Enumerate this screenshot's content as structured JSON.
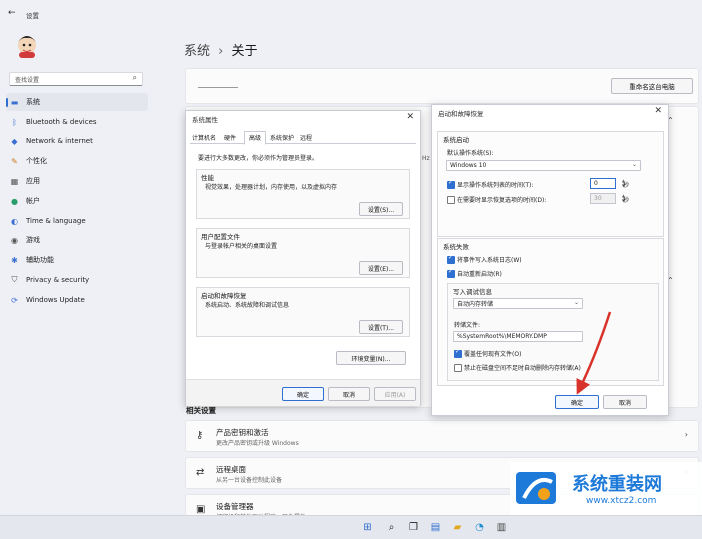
{
  "window": {
    "back_glyph": "←",
    "title": "设置"
  },
  "sidebar": {
    "search_placeholder": "查找设置",
    "items": [
      {
        "label": "系统",
        "icon": "monitor-icon",
        "glyph": "▬"
      },
      {
        "label": "Bluetooth & devices",
        "icon": "bluetooth-icon",
        "glyph": "ᛒ"
      },
      {
        "label": "Network & internet",
        "icon": "wifi-icon",
        "glyph": "◆"
      },
      {
        "label": "个性化",
        "icon": "brush-icon",
        "glyph": "✎"
      },
      {
        "label": "应用",
        "icon": "apps-icon",
        "glyph": "▦"
      },
      {
        "label": "帐户",
        "icon": "person-icon",
        "glyph": "●"
      },
      {
        "label": "Time & language",
        "icon": "globe-clock-icon",
        "glyph": "◐"
      },
      {
        "label": "游戏",
        "icon": "gamepad-icon",
        "glyph": "◉"
      },
      {
        "label": "辅助功能",
        "icon": "accessibility-icon",
        "glyph": "✱"
      },
      {
        "label": "Privacy & security",
        "icon": "shield-icon",
        "glyph": "⛉"
      },
      {
        "label": "Windows Update",
        "icon": "update-icon",
        "glyph": "⟳"
      }
    ]
  },
  "main": {
    "breadcrumb_root": "系统",
    "breadcrumb_sep": "›",
    "breadcrumb_current": "关于",
    "rename_button": "重命名这台电脑",
    "related_heading": "相关设置",
    "related": [
      {
        "title": "产品密钥和激活",
        "subtitle": "更改产品密钥或升级 Windows",
        "icon": "key-icon",
        "glyph": "⚷",
        "arrow": "›"
      },
      {
        "title": "远程桌面",
        "subtitle": "从另一台设备控制此设备",
        "icon": "remote-desktop-icon",
        "glyph": "⇄",
        "arrow": "›"
      },
      {
        "title": "设备管理器",
        "subtitle": "打印机和其他驱动程序、硬件属性",
        "icon": "device-manager-icon",
        "glyph": "▣",
        "arrow": ""
      }
    ],
    "partial_text": "Hz"
  },
  "system_properties": {
    "title": "系统属性",
    "tabs": [
      "计算机名",
      "硬件",
      "高级",
      "系统保护",
      "远程"
    ],
    "admin_note": "要进行大多数更改，你必须作为管理员登录。",
    "performance": {
      "label": "性能",
      "desc": "视觉效果，处理器计划，内存使用，以及虚拟内存",
      "button": "设置(S)..."
    },
    "user_profiles": {
      "label": "用户配置文件",
      "desc": "与登录帐户相关的桌面设置",
      "button": "设置(E)..."
    },
    "startup_recovery": {
      "label": "启动和故障恢复",
      "desc": "系统启动、系统故障和调试信息",
      "button": "设置(T)..."
    },
    "env_button": "环境变量(N)...",
    "ok": "确定",
    "cancel": "取消",
    "apply": "应用(A)"
  },
  "startup_recovery": {
    "title": "启动和故障恢复",
    "system_startup": "系统启动",
    "default_os_label": "默认操作系统(S):",
    "default_os_value": "Windows 10",
    "show_os_list": "显示操作系统列表的时间(T):",
    "show_os_list_value": "0",
    "show_os_list_checked": true,
    "show_recovery": "在需要时显示恢复选项的时间(D):",
    "show_recovery_value": "30",
    "show_recovery_checked": false,
    "seconds_unit": "秒",
    "system_failure": "系统失败",
    "write_event_log": "将事件写入系统日志(W)",
    "auto_restart": "自动重新启动(R)",
    "write_debug_info": "写入调试信息",
    "debug_type": "自动内存转储",
    "dump_file_label": "转储文件:",
    "dump_file_value": "%SystemRoot%\\MEMORY.DMP",
    "overwrite": "覆盖任何现有文件(O)",
    "disable_auto_delete": "禁止在磁盘空间不足时自动删除内存转储(A)",
    "ok": "确定",
    "cancel": "取消"
  },
  "watermark": {
    "text": "系统重装网",
    "url": "www.xtcz2.com"
  },
  "colors": {
    "accent": "#2f6fd0",
    "annotation_arrow": "#d8322a"
  },
  "taskbar": {
    "icons": [
      {
        "icon": "windows-start-icon",
        "glyph": "⊞"
      },
      {
        "icon": "search-icon",
        "glyph": "⌕"
      },
      {
        "icon": "task-view-icon",
        "glyph": "❐"
      },
      {
        "icon": "widgets-icon",
        "glyph": "▤"
      },
      {
        "icon": "file-explorer-icon",
        "glyph": "▰"
      },
      {
        "icon": "edge-icon",
        "glyph": "◔"
      },
      {
        "icon": "store-icon",
        "glyph": "▥"
      }
    ]
  }
}
